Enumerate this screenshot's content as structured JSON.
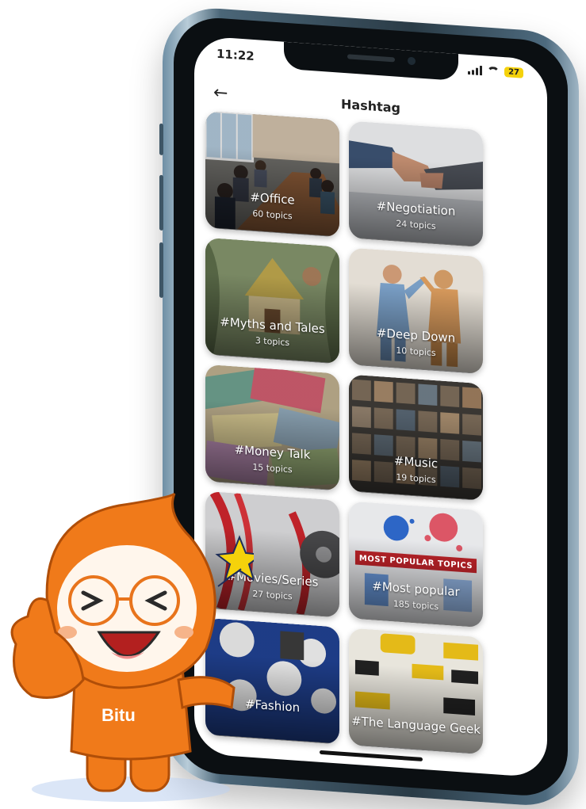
{
  "status": {
    "time": "11:22",
    "battery": "27"
  },
  "header": {
    "title": "Hashtag",
    "back_icon": "arrow-left-icon"
  },
  "hashtags": [
    {
      "tag": "#Office",
      "count": "60 topics"
    },
    {
      "tag": "#Negotiation",
      "count": "24 topics"
    },
    {
      "tag": "#Myths and Tales",
      "count": "3 topics"
    },
    {
      "tag": "#Deep Down",
      "count": "10 topics"
    },
    {
      "tag": "#Money Talk",
      "count": "15 topics"
    },
    {
      "tag": "#Music",
      "count": "19 topics"
    },
    {
      "tag": "#Movies/Series",
      "count": "27 topics"
    },
    {
      "tag": "#Most popular",
      "count": "185 topics"
    },
    {
      "tag": "#Fashion",
      "count": ""
    },
    {
      "tag": "#The Language Geek",
      "count": ""
    }
  ],
  "mascot": {
    "name": "Bitu"
  },
  "colors": {
    "mascot_orange": "#f07a1a",
    "battery_yellow": "#f5d20b"
  }
}
